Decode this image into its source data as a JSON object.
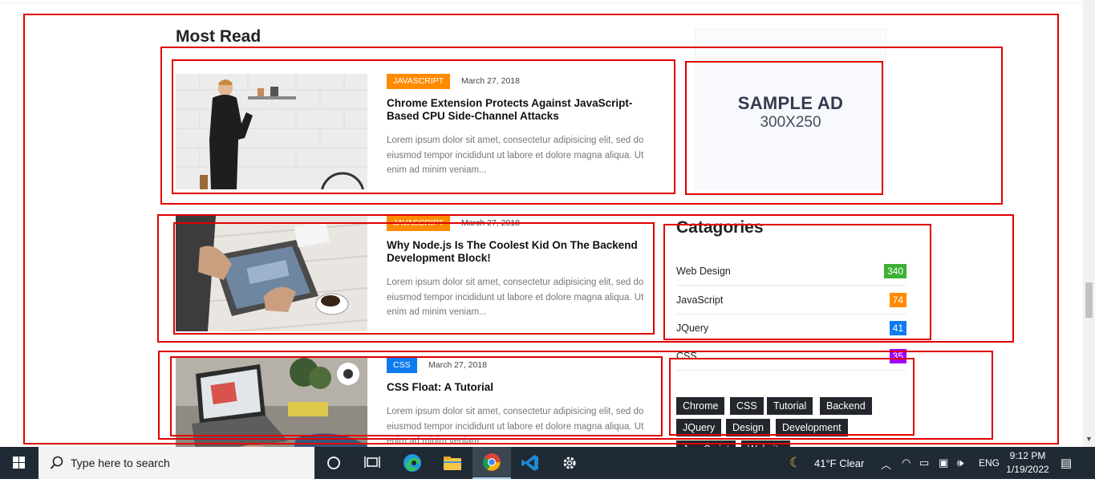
{
  "most_read": {
    "title": "Most Read",
    "posts": [
      {
        "tag": "JAVASCRIPT",
        "tag_color": "#ff8a00",
        "date": "March 27, 2018",
        "title": "Chrome Extension Protects Against JavaScript-Based CPU Side-Channel Attacks",
        "excerpt": "Lorem ipsum dolor sit amet, consectetur adipisicing elit, sed do eiusmod tempor incididunt ut labore et dolore magna aliqua. Ut enim ad minim veniam..."
      },
      {
        "tag": "JAVASCRIPT",
        "tag_color": "#ff8a00",
        "date": "March 27, 2018",
        "title": "Why Node.js Is The Coolest Kid On The Backend Development Block!",
        "excerpt": "Lorem ipsum dolor sit amet, consectetur adipisicing elit, sed do eiusmod tempor incididunt ut labore et dolore magna aliqua. Ut enim ad minim veniam..."
      },
      {
        "tag": "CSS",
        "tag_color": "#0f7bf0",
        "date": "March 27, 2018",
        "title": "CSS Float: A Tutorial",
        "excerpt": "Lorem ipsum dolor sit amet, consectetur adipisicing elit, sed do eiusmod tempor incididunt ut labore et dolore magna aliqua. Ut enim ad minim veniam..."
      }
    ]
  },
  "ad": {
    "line1": "SAMPLE AD",
    "line2": "300X250"
  },
  "categories": {
    "title": "Catagories",
    "items": [
      {
        "name": "Web Design",
        "count": "340",
        "color": "#3cb034"
      },
      {
        "name": "JavaScript",
        "count": "74",
        "color": "#ff8a00"
      },
      {
        "name": "JQuery",
        "count": "41",
        "color": "#0f7bf0"
      },
      {
        "name": "CSS",
        "count": "35",
        "color": "#a100ff"
      }
    ]
  },
  "tags": [
    "Chrome",
    "CSS",
    "Tutorial",
    "Backend",
    "JQuery",
    "Design",
    "Development",
    "JavaScript",
    "Website"
  ],
  "taskbar": {
    "search_placeholder": "Type here to search",
    "weather": "41°F  Clear",
    "language": "ENG",
    "time": "9:12 PM",
    "date": "1/19/2022"
  }
}
